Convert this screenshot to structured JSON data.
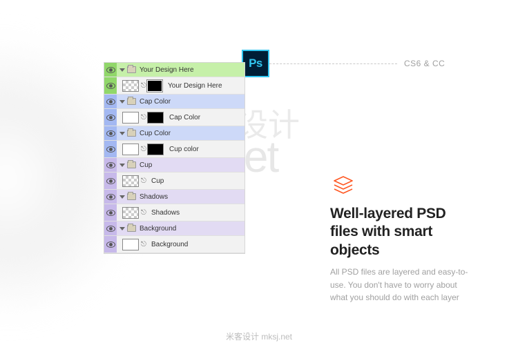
{
  "top_label": "CS6 & CC",
  "ps_badge": "Ps",
  "layers": {
    "groups": [
      {
        "tint": "green",
        "name": "Your Design Here",
        "child": {
          "thumb1": "checker",
          "thumb2": "mask",
          "label": "Your Design Here"
        }
      },
      {
        "tint": "blue",
        "name": "Cap Color",
        "child": {
          "thumb1": "white",
          "thumb2": "black",
          "label": "Cap Color"
        }
      },
      {
        "tint": "blue",
        "name": "Cup Color",
        "child": {
          "thumb1": "white",
          "thumb2": "black",
          "label": "Cup color"
        }
      },
      {
        "tint": "violet",
        "name": "Cup",
        "child": {
          "thumb1": "checker",
          "thumb2": null,
          "label": "Cup"
        }
      },
      {
        "tint": "violet",
        "name": "Shadows",
        "child": {
          "thumb1": "checker",
          "thumb2": null,
          "label": "Shadows"
        }
      },
      {
        "tint": "violet",
        "name": "Background",
        "child": {
          "thumb1": "white",
          "thumb2": null,
          "label": "Background"
        }
      }
    ]
  },
  "heading": "Well-layered PSD files with smart objects",
  "body": "All PSD files are layered and easy-to-use. You don't have to worry about what you should do with each layer",
  "watermark_cn": "米客设计",
  "watermark_url": "mksj.net",
  "footer": "米客设计 mksj.net"
}
